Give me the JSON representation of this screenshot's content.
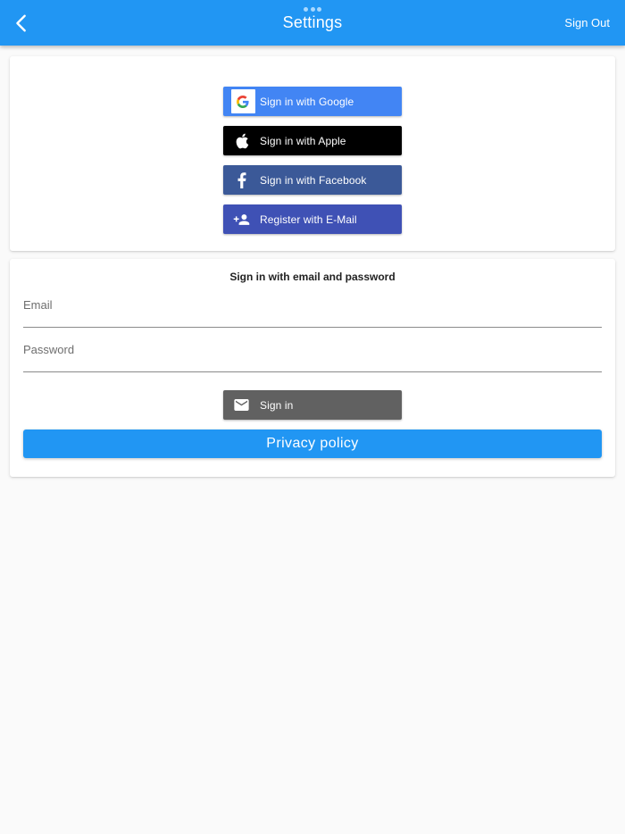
{
  "appbar": {
    "title": "Settings",
    "sign_out_label": "Sign Out",
    "background": "#2196f3"
  },
  "social_card": {
    "buttons": [
      {
        "label": "Sign in with Google",
        "icon": "google-icon",
        "color": "#4285f4"
      },
      {
        "label": "Sign in with Apple",
        "icon": "apple-icon",
        "color": "#000000"
      },
      {
        "label": "Sign in with Facebook",
        "icon": "facebook-icon",
        "color": "#3b5998"
      },
      {
        "label": "Register with E-Mail",
        "icon": "person-add-icon",
        "color": "#3f51b5"
      }
    ]
  },
  "email_card": {
    "heading": "Sign in with email and password",
    "email_placeholder": "Email",
    "email_value": "",
    "password_placeholder": "Password",
    "password_value": "",
    "sign_in_label": "Sign in",
    "sign_in_icon": "mail-icon",
    "privacy_label": "Privacy policy"
  }
}
